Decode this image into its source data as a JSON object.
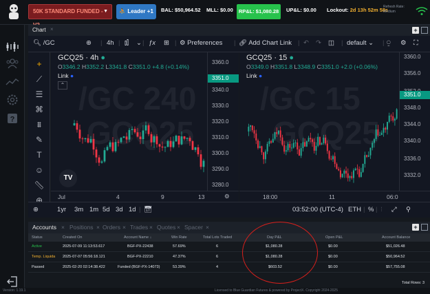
{
  "topbar": {
    "account_label": "50K STANDARD FUNDED - V2...",
    "leader_label": "Leader +1",
    "bal": "BAL: $50,964.52",
    "mll": "MLL: $0.00",
    "rpl": "RP&L: $1,080.28",
    "upl": "UP&L: $0.00",
    "lockout_label": "Lockout:",
    "lockout_value": "2d 13h 52m 58s",
    "refresh_label": "Refresh Rate:",
    "refresh_value": "Medium"
  },
  "chart_panel": {
    "tab": "Chart",
    "symbol": "/GC",
    "interval": "4h",
    "preferences": "Preferences",
    "add_chart": "Add Chart Link",
    "layout": "default"
  },
  "left_pane": {
    "title": "GCQ25 · 4h",
    "ohlc_o": "O",
    "ohlc_o_val": "3346.2",
    "ohlc_h": "H",
    "ohlc_h_val": "3352.2",
    "ohlc_l": "L",
    "ohlc_l_val": "3341.8",
    "ohlc_c": "C",
    "ohlc_c_val": "3351.0",
    "change": "+4.8 (+0.14%)",
    "link": "Link",
    "watermark1": "/GC 240",
    "watermark2": "GCQ25",
    "yticks": [
      "3360.0",
      "3340.0",
      "3330.0",
      "3320.0",
      "3310.0",
      "3300.0",
      "3290.0",
      "3280.0"
    ],
    "price_tag": "3351.0",
    "xticks": [
      "Jul",
      "4",
      "9",
      "13"
    ]
  },
  "right_pane": {
    "title": "GCQ25 · 15",
    "ohlc_o": "O",
    "ohlc_o_val": "3349.0",
    "ohlc_h": "H",
    "ohlc_h_val": "3351.8",
    "ohlc_l": "L",
    "ohlc_l_val": "3348.9",
    "ohlc_c": "C",
    "ohlc_c_val": "3351.0",
    "change": "+2.0 (+0.06%)",
    "link": "Link",
    "watermark1": "/GC 15",
    "watermark2": "GCQ25",
    "yticks": [
      "3360.0",
      "3356.0",
      "3352.0",
      "3348.0",
      "3344.0",
      "3340.0",
      "3336.0",
      "3332.0"
    ],
    "price_tag": "3351.0",
    "xticks": [
      "18:00",
      "11",
      "06:0"
    ]
  },
  "bottom_toolbar": {
    "ranges": [
      "1yr",
      "3m",
      "1m",
      "5d",
      "3d",
      "1d"
    ],
    "time": "03:52:00 (UTC-4)",
    "session": "ETH",
    "pct": "%"
  },
  "accounts": {
    "tabs": [
      "Accounts",
      "Positions",
      "Orders",
      "Trades",
      "Quotes",
      "Spacer"
    ],
    "headers": [
      "Status",
      "Created On",
      "Account Name",
      "Win Rate",
      "Total Lots Traded",
      "Day P&L",
      "Open P&L",
      "Account Balance"
    ],
    "rows": [
      {
        "status": "Active",
        "created": "2025-07-09 11:13:53.617",
        "name": "BGF-PX-22438",
        "win": "57.69%",
        "lots": "6",
        "day": "$1,080.28",
        "open": "$0.00",
        "balance": "$51,026.48"
      },
      {
        "status": "Temp. Liquida",
        "created": "2025-07-07 05:56:18.121",
        "name": "BGF-PX-22210",
        "win": "47.37%",
        "lots": "6",
        "day": "$1,080.28",
        "open": "$0.00",
        "balance": "$50,964.52"
      },
      {
        "status": "Passed",
        "created": "2025-02-20 02:14:38.422",
        "name": "Funded (BGF-PX-14073)",
        "win": "53.39%",
        "lots": "4",
        "day": "$603.52",
        "open": "$0.00",
        "balance": "$57,755.08"
      }
    ],
    "total_rows": "Total Rows: 3"
  },
  "footer": {
    "version": "Version: 1.19.1",
    "license": "Licensed to Blue Guardian Futures & powered by ProjectX. Copyright 2024-2025"
  },
  "colors": {
    "up": "#22ab94",
    "down": "#f23645",
    "active": "#27c24c",
    "temp": "#f2b030",
    "annotation": "#d8201c"
  }
}
